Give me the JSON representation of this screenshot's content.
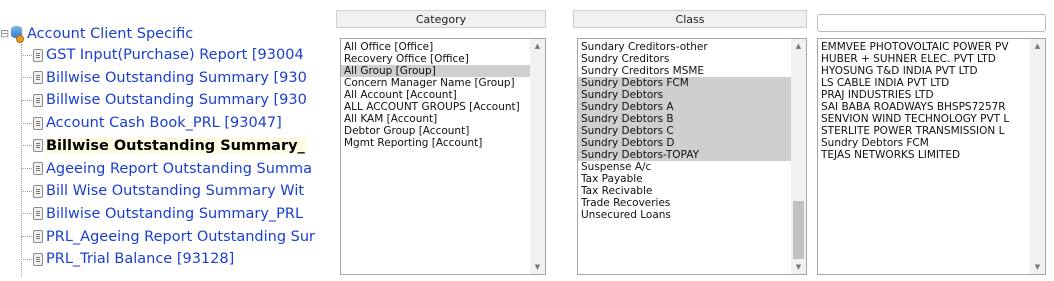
{
  "tree": {
    "root_label": "Account Client Specific",
    "items": [
      {
        "label": "GST Input(Purchase) Report [93004"
      },
      {
        "label": "Billwise Outstanding Summary [930"
      },
      {
        "label": "Billwise Outstanding Summary [930"
      },
      {
        "label": "Account Cash Book_PRL [93047]"
      },
      {
        "label": "Billwise Outstanding Summary_",
        "selected": true
      },
      {
        "label": "Ageeing Report Outstanding Summa"
      },
      {
        "label": "Bill Wise Outstanding Summary Wit"
      },
      {
        "label": "Billwise Outstanding Summary_PRL"
      },
      {
        "label": "PRL_Ageeing Report Outstanding Sur"
      },
      {
        "label": "PRL_Trial Balance [93128]"
      }
    ]
  },
  "category": {
    "header": "Category",
    "options": [
      {
        "label": "All Office [Office]"
      },
      {
        "label": "Recovery Office [Office]"
      },
      {
        "label": "All Group [Group]",
        "selected": true
      },
      {
        "label": "Concern Manager Name [Group]"
      },
      {
        "label": "All Account [Account]"
      },
      {
        "label": "ALL ACCOUNT GROUPS [Account]"
      },
      {
        "label": "All KAM [Account]"
      },
      {
        "label": "Debtor Group [Account]"
      },
      {
        "label": "Mgmt Reporting [Account]"
      }
    ]
  },
  "class": {
    "header": "Class",
    "options": [
      {
        "label": "Sundary Creditors-other"
      },
      {
        "label": "Sundry Creditors"
      },
      {
        "label": "Sundry Creditors MSME"
      },
      {
        "label": "Sundry Debtors FCM",
        "selected": true
      },
      {
        "label": "Sundry Debtors",
        "selected": true
      },
      {
        "label": "Sundry Debtors A",
        "selected": true
      },
      {
        "label": "Sundry Debtors B",
        "selected": true
      },
      {
        "label": "Sundry Debtors C",
        "selected": true
      },
      {
        "label": "Sundry Debtors D",
        "selected": true
      },
      {
        "label": "Sundry Debtors-TOPAY",
        "selected": true
      },
      {
        "label": "Suspense A/c"
      },
      {
        "label": "Tax Payable"
      },
      {
        "label": "Tax Recivable"
      },
      {
        "label": "Trade Recoveries"
      },
      {
        "label": "Unsecured Loans"
      }
    ]
  },
  "accounts": {
    "search_value": "",
    "options": [
      {
        "label": "EMMVEE PHOTOVOLTAIC POWER PV"
      },
      {
        "label": "HUBER + SUHNER ELEC. PVT LTD"
      },
      {
        "label": "HYOSUNG T&D INDIA PVT LTD"
      },
      {
        "label": "LS CABLE INDIA PVT LTD"
      },
      {
        "label": "PRAJ INDUSTRIES LTD"
      },
      {
        "label": "SAI BABA ROADWAYS BHSPS7257R"
      },
      {
        "label": "SENVION WIND TECHNOLOGY PVT L"
      },
      {
        "label": "STERLITE POWER TRANSMISSION L"
      },
      {
        "label": "Sundry Debtors FCM"
      },
      {
        "label": "TEJAS NETWORKS LIMITED"
      }
    ]
  },
  "colors": {
    "link": "#1a3fd0",
    "selected_bg": "#cfcfcf",
    "highlight_bg": "#fdfbe0"
  },
  "icons": {
    "root": "database-icon",
    "item": "report-document-icon"
  }
}
